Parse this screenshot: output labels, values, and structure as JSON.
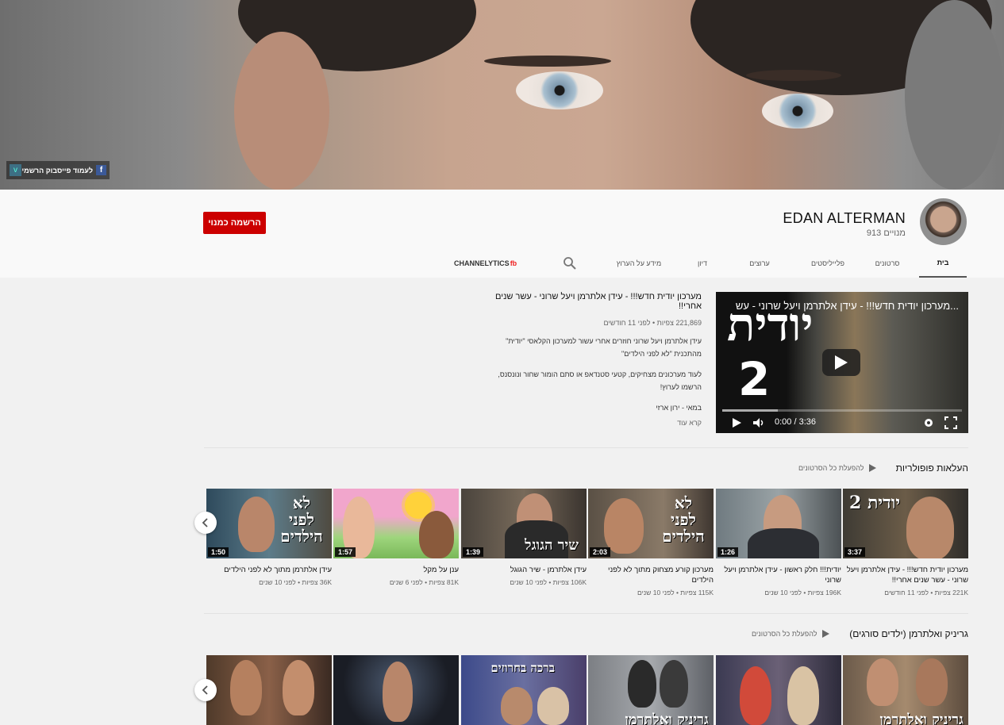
{
  "banner": {
    "facebook_link": "לעמוד פייסבוק הרשמי",
    "facebook_icon": "f",
    "vimeo_icon": "v"
  },
  "channel": {
    "name": "EDAN ALTERMAN",
    "subscribers": "913 מנויים",
    "subscribe_label": "הרשמה כמנוי"
  },
  "tabs": [
    {
      "label": "בית",
      "active": true
    },
    {
      "label": "סרטונים"
    },
    {
      "label": "פלייליסטים"
    },
    {
      "label": "ערוצים"
    },
    {
      "label": "דיון"
    },
    {
      "label": "מידע על הערוץ"
    }
  ],
  "channelytics": {
    "label": "CHANNELYTICS",
    "suffix": "fb"
  },
  "featured": {
    "overlay_title": "מערכון יודית חדש!!! - עידן אלתרמן ויעל שרוני - עש...",
    "title": "מערכון יודית חדש!!! - עידן אלתרמן ויעל שרוני - עשר שנים אחרי!!",
    "meta": "221,869 צפיות • לפני 11 חודשים",
    "description": [
      "עידן אלתרמן ויעל שרוני חוזרים אחרי עשור למערכון הקלאסי \"יודית\" מהתכנית \"לא לפני הילדים\"",
      "לעוד מערכונים מצחיקים, קטעי סטנדאפ או סתם הומור שחור ונונסנס, הרשמו לערוץ!",
      "במאי - ירון ארזי"
    ],
    "read_more": "קרא עוד",
    "thumb_big": "יודית",
    "thumb_two": "2",
    "time": "0:00 / 3:36"
  },
  "shelf1": {
    "title": "העלאות פופולריות",
    "play_all": "להפעלת כל הסרטונים",
    "videos": [
      {
        "title": "מערכון יודית חדש!!! - עידן אלתרמן ויעל שרוני - עשר שנים אחרי!!",
        "meta": "221K צפיות • לפני 11 חודשים",
        "duration": "3:37",
        "overlay": "יודית 2"
      },
      {
        "title": "יודית!!! חלק ראשון - עידן אלתרמן ויעל שרוני",
        "meta": "196K צפיות • לפני 10 שנים",
        "duration": "1:26",
        "overlay": ""
      },
      {
        "title": "מערכון קורע מצחוק מתוך לא לפני הילדים",
        "meta": "115K צפיות • לפני 10 שנים",
        "duration": "2:03",
        "overlay": "לא לפני הילדים"
      },
      {
        "title": "עידן אלתרמן - שיר הגוגל",
        "meta": "106K צפיות • לפני 10 שנים",
        "duration": "1:39",
        "overlay": "שיר הגוגל"
      },
      {
        "title": "ענן על מקל",
        "meta": "81K צפיות • לפני 6 שנים",
        "duration": "1:57",
        "overlay": ""
      },
      {
        "title": "עידן אלתרמן מתוך לא לפני הילדים",
        "meta": "36K צפיות • לפני 10 שנים",
        "duration": "1:50",
        "overlay": "לא לפני הילדים"
      }
    ]
  },
  "shelf2": {
    "title": "גריניק ואלתרמן (ילדים סורגים)",
    "play_all": "להפעלת כל הסרטונים",
    "videos": [
      {
        "overlay": "גריניק ואלתרמן"
      },
      {
        "overlay": ""
      },
      {
        "overlay": "גריניק ואלתרמן"
      },
      {
        "overlay": "ברכה בחרוזים"
      },
      {
        "overlay": ""
      },
      {
        "overlay": ""
      }
    ]
  },
  "colors": {
    "subscribe": "#cc0000",
    "background": "#f1f1f1",
    "header": "#f9f9f9"
  }
}
